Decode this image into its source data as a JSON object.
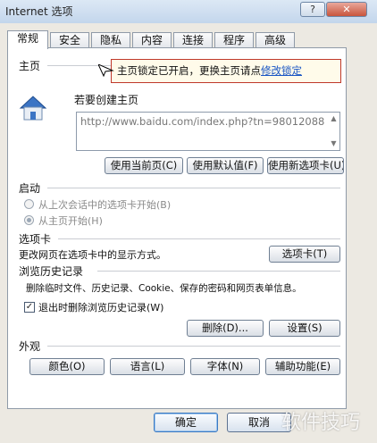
{
  "window": {
    "title": "Internet 选项",
    "help_glyph": "?",
    "close_glyph": "✕"
  },
  "tabs": [
    "常规",
    "安全",
    "隐私",
    "内容",
    "连接",
    "程序",
    "高级"
  ],
  "home": {
    "label": "主页",
    "instruction": "若要创建主页",
    "url": "http://www.baidu.com/index.php?tn=98012088",
    "buttons": {
      "current": "使用当前页(C)",
      "default": "使用默认值(F)",
      "new_tab": "使用新选项卡(U)"
    }
  },
  "tooltip": {
    "text": "主页锁定已开启，更换主页请点",
    "link": "修改锁定"
  },
  "startup": {
    "label": "启动",
    "option1": "从上次会话中的选项卡开始(B)",
    "option2": "从主页开始(H)"
  },
  "tabs_section": {
    "label": "选项卡",
    "description": "更改网页在选项卡中的显示方式。",
    "button": "选项卡(T)"
  },
  "history": {
    "label": "浏览历史记录",
    "description": "删除临时文件、历史记录、Cookie、保存的密码和网页表单信息。",
    "checkbox_label": "退出时删除浏览历史记录(W)",
    "checkbox_glyph": "✓",
    "delete_button": "删除(D)...",
    "settings_button": "设置(S)"
  },
  "appearance": {
    "label": "外观",
    "colors": "颜色(O)",
    "languages": "语言(L)",
    "fonts": "字体(N)",
    "accessibility": "辅助功能(E)"
  },
  "footer": {
    "ok": "确定",
    "cancel": "取消"
  },
  "watermark": "软件技巧",
  "colors": {
    "tooltip_border": "#c0392b",
    "link": "#1a56c4",
    "dialog_bg": "#ece9e2",
    "titlebar": "#c3d6ec"
  }
}
